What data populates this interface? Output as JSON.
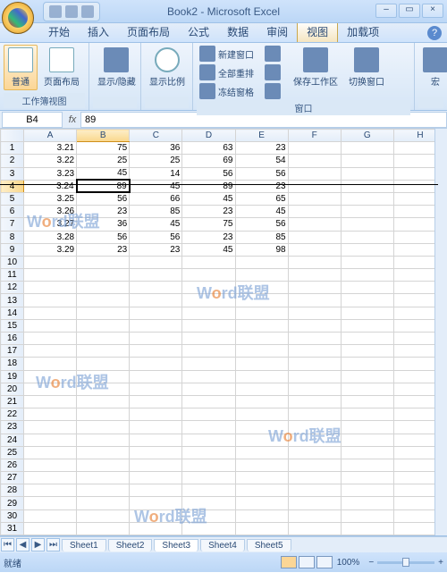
{
  "title": "Book2 - Microsoft Excel",
  "tabs": {
    "t0": "开始",
    "t1": "插入",
    "t2": "页面布局",
    "t3": "公式",
    "t4": "数据",
    "t5": "审阅",
    "t6": "视图",
    "t7": "加载项"
  },
  "ribbon": {
    "views": {
      "normal": "普通",
      "layout": "页面布局",
      "label": "工作簿视图"
    },
    "showhide": "显示/隐藏",
    "zoom": "显示比例",
    "window": {
      "new": "新建窗口",
      "arrange": "全部重排",
      "freeze": "冻结窗格",
      "save": "保存工作区",
      "switch": "切换窗口",
      "label": "窗口"
    },
    "macro": "宏"
  },
  "namebox": "B4",
  "formula": "89",
  "cols": [
    "A",
    "B",
    "C",
    "D",
    "E",
    "F",
    "G",
    "H"
  ],
  "rows": [
    {
      "n": 1,
      "a": "3.21",
      "b": "75",
      "c": "36",
      "d": "63",
      "e": "23"
    },
    {
      "n": 2,
      "a": "3.22",
      "b": "25",
      "c": "25",
      "d": "69",
      "e": "54"
    },
    {
      "n": 3,
      "a": "3.23",
      "b": "45",
      "c": "14",
      "d": "56",
      "e": "56"
    },
    {
      "n": 4,
      "a": "3.24",
      "b": "89",
      "c": "45",
      "d": "89",
      "e": "23"
    },
    {
      "n": 5,
      "a": "3.25",
      "b": "56",
      "c": "66",
      "d": "45",
      "e": "65"
    },
    {
      "n": 6,
      "a": "3.26",
      "b": "23",
      "c": "85",
      "d": "23",
      "e": "45"
    },
    {
      "n": 7,
      "a": "3.27",
      "b": "36",
      "c": "45",
      "d": "75",
      "e": "56"
    },
    {
      "n": 8,
      "a": "3.28",
      "b": "56",
      "c": "56",
      "d": "23",
      "e": "85"
    },
    {
      "n": 9,
      "a": "3.29",
      "b": "23",
      "c": "23",
      "d": "45",
      "e": "98"
    }
  ],
  "sheets": {
    "s1": "Sheet1",
    "s2": "Sheet2",
    "s3": "Sheet3",
    "s4": "Sheet4",
    "s5": "Sheet5"
  },
  "status": {
    "ready": "就绪",
    "zoom": "100%",
    "plus": "+",
    "minus": "−"
  }
}
